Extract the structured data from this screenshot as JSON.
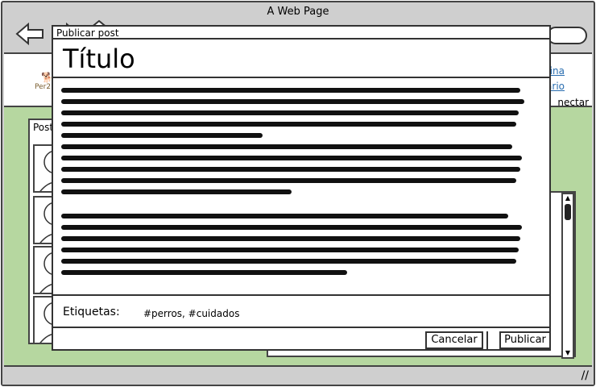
{
  "window": {
    "title": "A Web Page"
  },
  "header": {
    "logo_text": "Per2",
    "link_1": "ina",
    "link_2": "ario",
    "connect": "nectar"
  },
  "left_panel": {
    "tab_label": "Post"
  },
  "dialog": {
    "header": "Publicar post",
    "title_field": "Título",
    "tags_label": "Etiquetas:",
    "tags_value": "#perros, #cuidados",
    "cancel_label": "Cancelar",
    "publish_label": "Publicar"
  }
}
